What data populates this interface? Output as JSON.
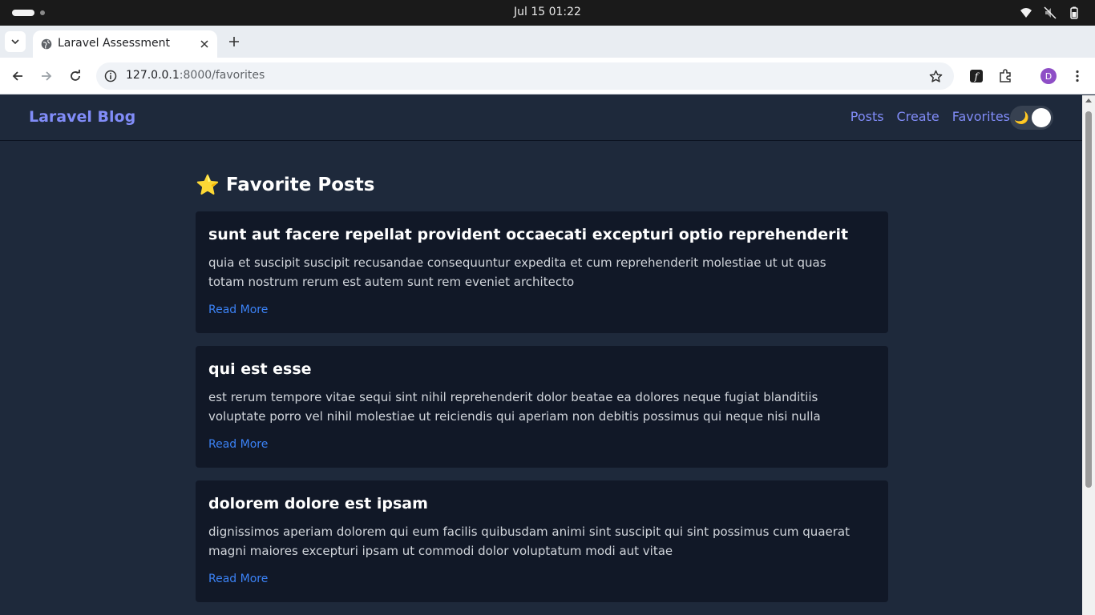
{
  "os": {
    "clock": "Jul 15  01:22",
    "tray_icons": [
      "wifi-icon",
      "speaker-muted-icon",
      "battery-icon"
    ]
  },
  "browser": {
    "tab_title": "Laravel Assessment",
    "url_host": "127.0.0.1",
    "url_path": ":8000/favorites",
    "profile_initial": "D"
  },
  "app": {
    "brand": "Laravel Blog",
    "nav": [
      {
        "label": "Posts"
      },
      {
        "label": "Create"
      },
      {
        "label": "Favorites"
      }
    ],
    "theme_toggle": {
      "mode": "dark",
      "icon": "moon-icon",
      "glyph": "🌙"
    }
  },
  "page": {
    "title_emoji": "⭐",
    "title": "Favorite Posts",
    "posts": [
      {
        "title": "sunt aut facere repellat provident occaecati excepturi optio reprehenderit",
        "body": "quia et suscipit suscipit recusandae consequuntur expedita et cum reprehenderit molestiae ut ut quas totam nostrum rerum est autem sunt rem eveniet architecto",
        "link": "Read More"
      },
      {
        "title": "qui est esse",
        "body": "est rerum tempore vitae sequi sint nihil reprehenderit dolor beatae ea dolores neque fugiat blanditiis voluptate porro vel nihil molestiae ut reiciendis qui aperiam non debitis possimus qui neque nisi nulla",
        "link": "Read More"
      },
      {
        "title": "dolorem dolore est ipsam",
        "body": "dignissimos aperiam dolorem qui eum facilis quibusdam animi sint suscipit qui sint possimus cum quaerat magni maiores excepturi ipsam ut commodi dolor voluptatum modi aut vitae",
        "link": "Read More"
      }
    ]
  },
  "colors": {
    "page_bg": "#1e293b",
    "card_bg": "#111827",
    "brand": "#818cf8",
    "link": "#3b82f6"
  }
}
